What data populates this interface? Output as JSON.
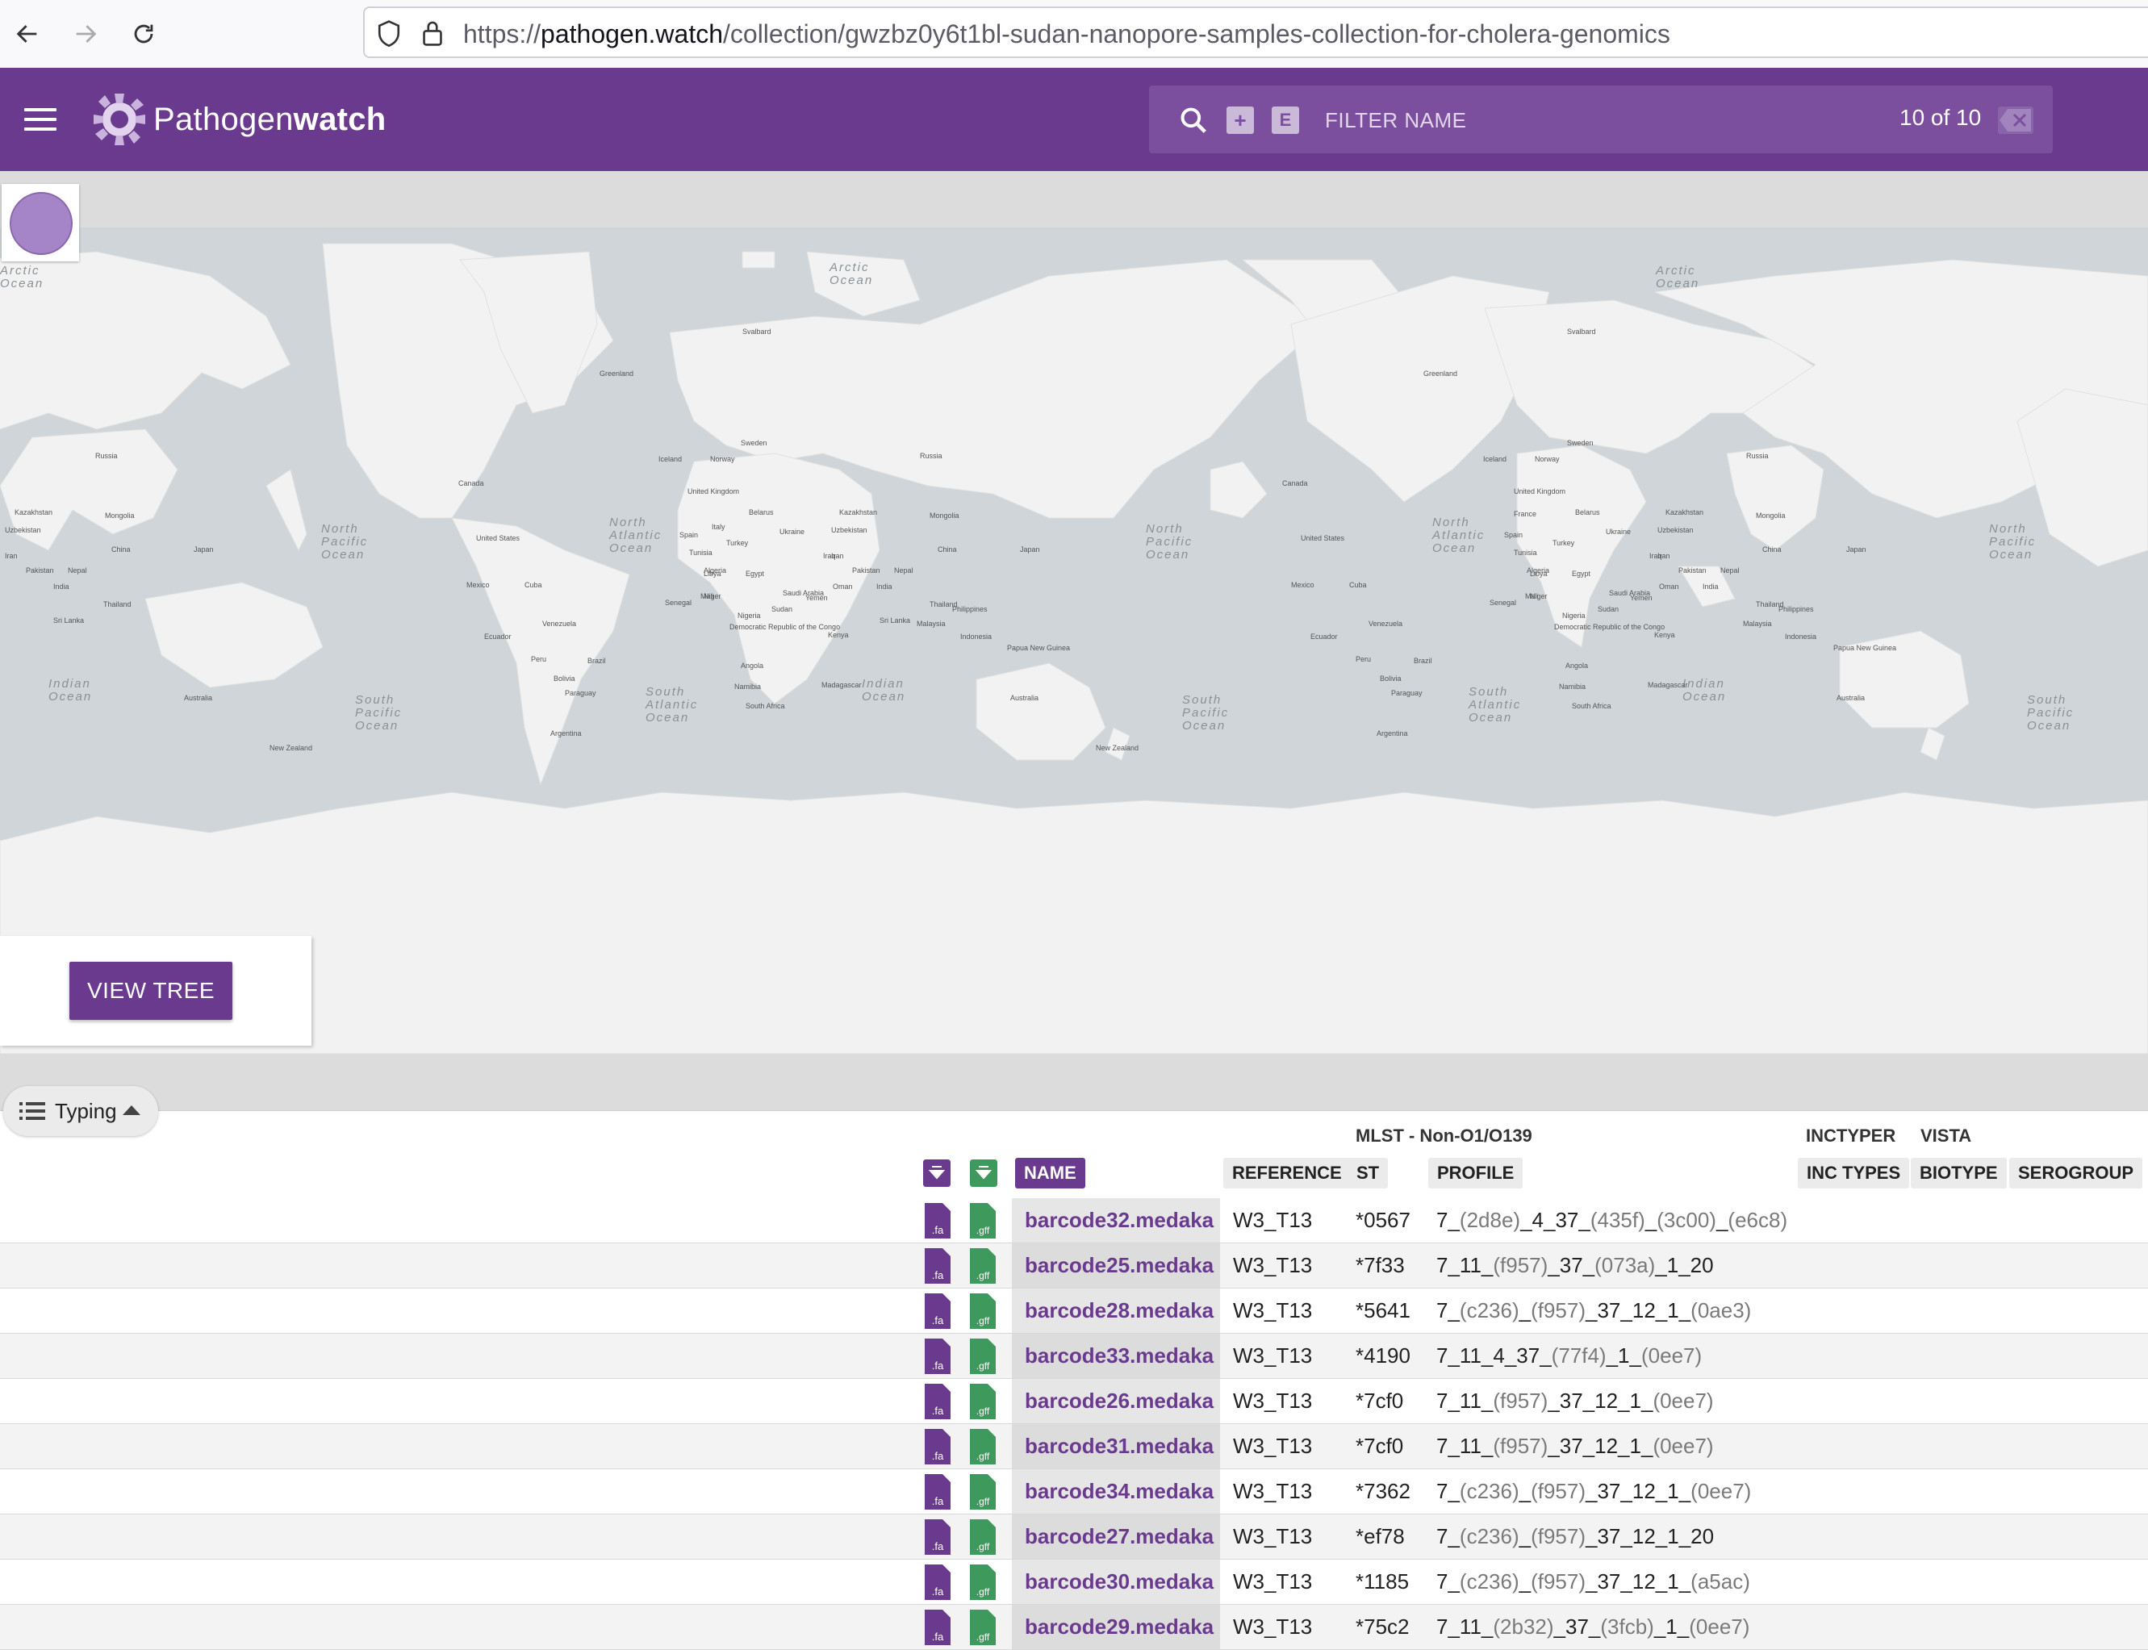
{
  "browser": {
    "url_prefix": "https://",
    "url_host": "pathogen.watch",
    "url_path": "/collection/gwzbz0y6t1bl-sudan-nanopore-samples-collection-for-cholera-genomics"
  },
  "header": {
    "brand_light": "Pathogen",
    "brand_bold": "watch",
    "filter_placeholder": "FILTER NAME",
    "filter_count": "10 of 10",
    "plus_label": "+",
    "e_label": "E"
  },
  "map": {
    "labels": [
      {
        "text": "Arctic Ocean"
      },
      {
        "text": "Arctic Ocean"
      },
      {
        "text": "Arctic Ocean"
      },
      {
        "text": "North Pacific Ocean"
      },
      {
        "text": "North Atlantic Ocean"
      },
      {
        "text": "North Pacific Ocean"
      },
      {
        "text": "North Atlantic Ocean"
      },
      {
        "text": "North Pacific Ocean"
      },
      {
        "text": "South Pacific Ocean"
      },
      {
        "text": "South Atlantic Ocean"
      },
      {
        "text": "Indian Ocean"
      },
      {
        "text": "South Pacific Ocean"
      },
      {
        "text": "South Atlantic Ocean"
      },
      {
        "text": "Indian Ocean"
      },
      {
        "text": "South Pacific Ocean"
      },
      {
        "text": "Indian Ocean"
      },
      {
        "text": "Greenland"
      },
      {
        "text": "Greenland"
      },
      {
        "text": "Canada"
      },
      {
        "text": "Canada"
      },
      {
        "text": "Russia"
      },
      {
        "text": "Russia"
      },
      {
        "text": "Russia"
      },
      {
        "text": "United States"
      },
      {
        "text": "United States"
      },
      {
        "text": "Brazil"
      },
      {
        "text": "Brazil"
      },
      {
        "text": "China"
      },
      {
        "text": "China"
      },
      {
        "text": "China"
      },
      {
        "text": "Australia"
      },
      {
        "text": "Australia"
      },
      {
        "text": "Australia"
      },
      {
        "text": "Kazakhstan"
      },
      {
        "text": "Kazakhstan"
      },
      {
        "text": "Kazakhstan"
      },
      {
        "text": "Mongolia"
      },
      {
        "text": "Mongolia"
      },
      {
        "text": "Mongolia"
      },
      {
        "text": "India"
      },
      {
        "text": "India"
      },
      {
        "text": "India"
      },
      {
        "text": "Sudan"
      },
      {
        "text": "Sudan"
      },
      {
        "text": "Niger"
      },
      {
        "text": "Niger"
      },
      {
        "text": "Angola"
      },
      {
        "text": "Angola"
      },
      {
        "text": "Algeria"
      },
      {
        "text": "Algeria"
      },
      {
        "text": "Libya"
      },
      {
        "text": "Libya"
      },
      {
        "text": "Egypt"
      },
      {
        "text": "Egypt"
      },
      {
        "text": "Mali"
      },
      {
        "text": "Mali"
      },
      {
        "text": "Kenya"
      },
      {
        "text": "Kenya"
      },
      {
        "text": "Nigeria"
      },
      {
        "text": "Nigeria"
      },
      {
        "text": "Namibia"
      },
      {
        "text": "Namibia"
      },
      {
        "text": "South Africa"
      },
      {
        "text": "South Africa"
      },
      {
        "text": "Madagascar"
      },
      {
        "text": "Madagascar"
      },
      {
        "text": "Iran"
      },
      {
        "text": "Iran"
      },
      {
        "text": "Iran"
      },
      {
        "text": "Pakistan"
      },
      {
        "text": "Pakistan"
      },
      {
        "text": "Pakistan"
      },
      {
        "text": "Nepal"
      },
      {
        "text": "Nepal"
      },
      {
        "text": "Nepal"
      },
      {
        "text": "Thailand"
      },
      {
        "text": "Thailand"
      },
      {
        "text": "Thailand"
      },
      {
        "text": "Japan"
      },
      {
        "text": "Japan"
      },
      {
        "text": "Japan"
      },
      {
        "text": "Peru"
      },
      {
        "text": "Peru"
      },
      {
        "text": "Bolivia"
      },
      {
        "text": "Bolivia"
      },
      {
        "text": "Venezuela"
      },
      {
        "text": "Venezuela"
      },
      {
        "text": "Argentina"
      },
      {
        "text": "Argentina"
      },
      {
        "text": "Mexico"
      },
      {
        "text": "Mexico"
      },
      {
        "text": "Cuba"
      },
      {
        "text": "Cuba"
      },
      {
        "text": "Ukraine"
      },
      {
        "text": "Ukraine"
      },
      {
        "text": "Turkey"
      },
      {
        "text": "Turkey"
      },
      {
        "text": "Sweden"
      },
      {
        "text": "Sweden"
      },
      {
        "text": "Norway"
      },
      {
        "text": "Norway"
      },
      {
        "text": "Iceland"
      },
      {
        "text": "Iceland"
      },
      {
        "text": "Svalbard"
      },
      {
        "text": "Svalbard"
      },
      {
        "text": "Uzbekistan"
      },
      {
        "text": "Uzbekistan"
      },
      {
        "text": "Uzbekistan"
      },
      {
        "text": "Indonesia"
      },
      {
        "text": "Indonesia"
      },
      {
        "text": "Philippines"
      },
      {
        "text": "Philippines"
      },
      {
        "text": "Malaysia"
      },
      {
        "text": "Malaysia"
      },
      {
        "text": "Papua New Guinea"
      },
      {
        "text": "Papua New Guinea"
      },
      {
        "text": "New Zealand"
      },
      {
        "text": "New Zealand"
      },
      {
        "text": "Sri Lanka"
      },
      {
        "text": "Sri Lanka"
      },
      {
        "text": "Ecuador"
      },
      {
        "text": "Ecuador"
      },
      {
        "text": "Paraguay"
      },
      {
        "text": "Paraguay"
      },
      {
        "text": "Senegal"
      },
      {
        "text": "Senegal"
      },
      {
        "text": "Saudi Arabia"
      },
      {
        "text": "Saudi Arabia"
      },
      {
        "text": "Yemen"
      },
      {
        "text": "Yemen"
      },
      {
        "text": "Oman"
      },
      {
        "text": "Oman"
      },
      {
        "text": "Iraq"
      },
      {
        "text": "Iraq"
      },
      {
        "text": "Tunisia"
      },
      {
        "text": "Tunisia"
      },
      {
        "text": "Spain"
      },
      {
        "text": "Spain"
      },
      {
        "text": "France"
      },
      {
        "text": "Italy"
      },
      {
        "text": "Belarus"
      },
      {
        "text": "Belarus"
      },
      {
        "text": "United Kingdom"
      },
      {
        "text": "United Kingdom"
      },
      {
        "text": "Democratic Republic of the Congo"
      },
      {
        "text": "Democratic Republic of the Congo"
      }
    ]
  },
  "view_tree_label": "VIEW TREE",
  "typing_label": "Typing",
  "table": {
    "group_mlst": "MLST - Non-O1/O139",
    "group_inctyper": "INCTYPER",
    "group_vista": "VISTA",
    "col_name": "NAME",
    "col_reference": "REFERENCE",
    "col_st": "ST",
    "col_profile": "PROFILE",
    "col_inc_types": "INC TYPES",
    "col_biotype": "BIOTYPE",
    "col_serogroup": "SEROGROUP",
    "fa_label": ".fa",
    "gff_label": ".gff",
    "rows": [
      {
        "name": "barcode32.medaka",
        "reference": "W3_T13",
        "st": "*0567",
        "profile": [
          [
            "7_",
            0
          ],
          [
            "(2d8e)",
            1
          ],
          [
            "_4_37_",
            0
          ],
          [
            "(435f)",
            1
          ],
          [
            "_",
            0
          ],
          [
            "(3c00)",
            1
          ],
          [
            "_",
            0
          ],
          [
            "(e6c8)",
            1
          ]
        ]
      },
      {
        "name": "barcode25.medaka",
        "reference": "W3_T13",
        "st": "*7f33",
        "profile": [
          [
            "7_11_",
            0
          ],
          [
            "(f957)",
            1
          ],
          [
            "_37_",
            0
          ],
          [
            "(073a)",
            1
          ],
          [
            "_1_20",
            0
          ]
        ]
      },
      {
        "name": "barcode28.medaka",
        "reference": "W3_T13",
        "st": "*5641",
        "profile": [
          [
            "7_",
            0
          ],
          [
            "(c236)",
            1
          ],
          [
            "_",
            0
          ],
          [
            "(f957)",
            1
          ],
          [
            "_37_12_1_",
            0
          ],
          [
            "(0ae3)",
            1
          ]
        ]
      },
      {
        "name": "barcode33.medaka",
        "reference": "W3_T13",
        "st": "*4190",
        "profile": [
          [
            "7_11_4_37_",
            0
          ],
          [
            "(77f4)",
            1
          ],
          [
            "_1_",
            0
          ],
          [
            "(0ee7)",
            1
          ]
        ]
      },
      {
        "name": "barcode26.medaka",
        "reference": "W3_T13",
        "st": "*7cf0",
        "profile": [
          [
            "7_11_",
            0
          ],
          [
            "(f957)",
            1
          ],
          [
            "_37_12_1_",
            0
          ],
          [
            "(0ee7)",
            1
          ]
        ]
      },
      {
        "name": "barcode31.medaka",
        "reference": "W3_T13",
        "st": "*7cf0",
        "profile": [
          [
            "7_11_",
            0
          ],
          [
            "(f957)",
            1
          ],
          [
            "_37_12_1_",
            0
          ],
          [
            "(0ee7)",
            1
          ]
        ]
      },
      {
        "name": "barcode34.medaka",
        "reference": "W3_T13",
        "st": "*7362",
        "profile": [
          [
            "7_",
            0
          ],
          [
            "(c236)",
            1
          ],
          [
            "_",
            0
          ],
          [
            "(f957)",
            1
          ],
          [
            "_37_12_1_",
            0
          ],
          [
            "(0ee7)",
            1
          ]
        ]
      },
      {
        "name": "barcode27.medaka",
        "reference": "W3_T13",
        "st": "*ef78",
        "profile": [
          [
            "7_",
            0
          ],
          [
            "(c236)",
            1
          ],
          [
            "_",
            0
          ],
          [
            "(f957)",
            1
          ],
          [
            "_37_12_1_20",
            0
          ]
        ]
      },
      {
        "name": "barcode30.medaka",
        "reference": "W3_T13",
        "st": "*1185",
        "profile": [
          [
            "7_",
            0
          ],
          [
            "(c236)",
            1
          ],
          [
            "_",
            0
          ],
          [
            "(f957)",
            1
          ],
          [
            "_37_12_1_",
            0
          ],
          [
            "(a5ac)",
            1
          ]
        ]
      },
      {
        "name": "barcode29.medaka",
        "reference": "W3_T13",
        "st": "*75c2",
        "profile": [
          [
            "7_11_",
            0
          ],
          [
            "(2b32)",
            1
          ],
          [
            "_37_",
            0
          ],
          [
            "(3fcb)",
            1
          ],
          [
            "_1_",
            0
          ],
          [
            "(0ee7)",
            1
          ]
        ]
      }
    ]
  },
  "colors": {
    "brand_purple": "#6a3a8e",
    "gff_green": "#3d9a5c",
    "legend_dot": "#a585c8"
  }
}
